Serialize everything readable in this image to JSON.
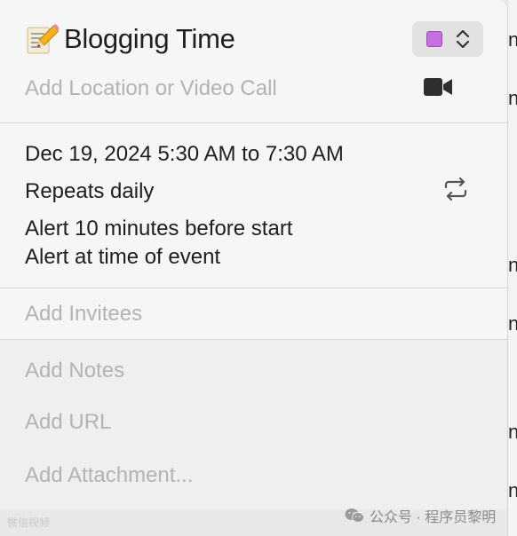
{
  "event": {
    "title": "Blogging Time",
    "title_icon": "memo-pencil-icon",
    "calendar_color": "#c66fe0",
    "location_placeholder": "Add Location or Video Call",
    "date_time": "Dec 19, 2024  5:30 AM to 7:30 AM",
    "repeat": "Repeats daily",
    "alert_1": "Alert 10 minutes before start",
    "alert_2": "Alert at time of event",
    "invitees_placeholder": "Add Invitees",
    "notes_placeholder": "Add Notes",
    "url_placeholder": "Add URL",
    "attachment_placeholder": "Add Attachment..."
  },
  "icons": {
    "video": "video-camera-icon",
    "repeat": "repeat-icon",
    "chevron": "chevron-up-down-icon"
  },
  "watermark": {
    "left": "微信视频",
    "right": "公众号 · 程序员黎明"
  },
  "background": {
    "peek_letters": [
      "n",
      "n",
      "n",
      "n",
      "n",
      "n"
    ]
  }
}
